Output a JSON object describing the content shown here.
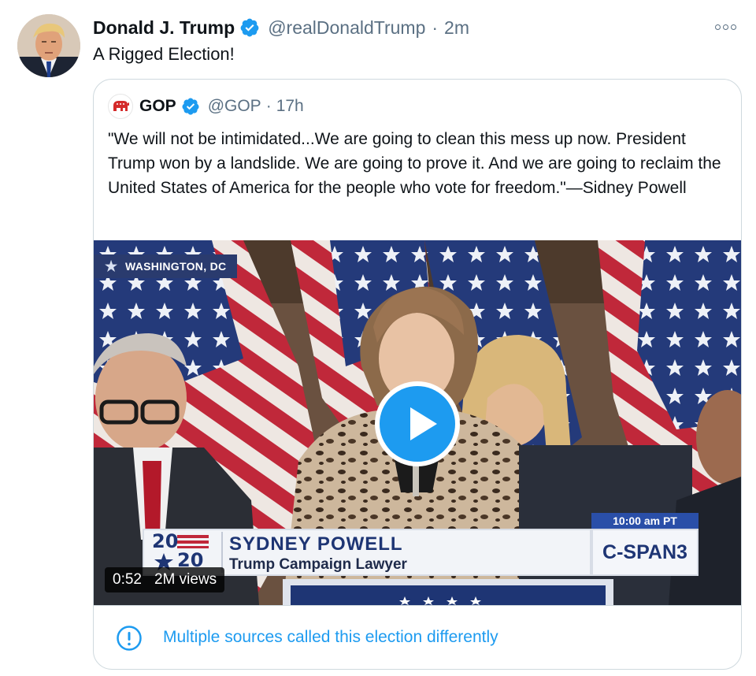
{
  "tweet": {
    "author_name": "Donald J. Trump",
    "handle": "@realDonaldTrump",
    "separator": "·",
    "time": "2m",
    "text": "A Rigged Election!"
  },
  "quoted_tweet": {
    "author_name": "GOP",
    "handle": "@GOP",
    "separator": "·",
    "time": "17h",
    "text": "\"We will not be intimidated...We are going to clean this mess up now. President Trump won by a landslide. We are going to prove it. And we are going to reclaim the United States of America for the people who vote for freedom.\"—Sidney Powell"
  },
  "video": {
    "location_tag": "WASHINGTON, DC",
    "lower_third_year_top": "20",
    "lower_third_year_bottom": "20",
    "speaker_name": "SYDNEY POWELL",
    "speaker_title": "Trump Campaign Lawyer",
    "broadcast_time": "10:00 am PT",
    "network": "C-SPAN3",
    "duration": "0:52",
    "views": "2M views"
  },
  "notice": {
    "text": "Multiple sources called this election differently",
    "icon": "info-icon"
  },
  "colors": {
    "accent": "#1d9bf0",
    "secondary_text": "#5b7083",
    "border": "#cfd9de"
  }
}
